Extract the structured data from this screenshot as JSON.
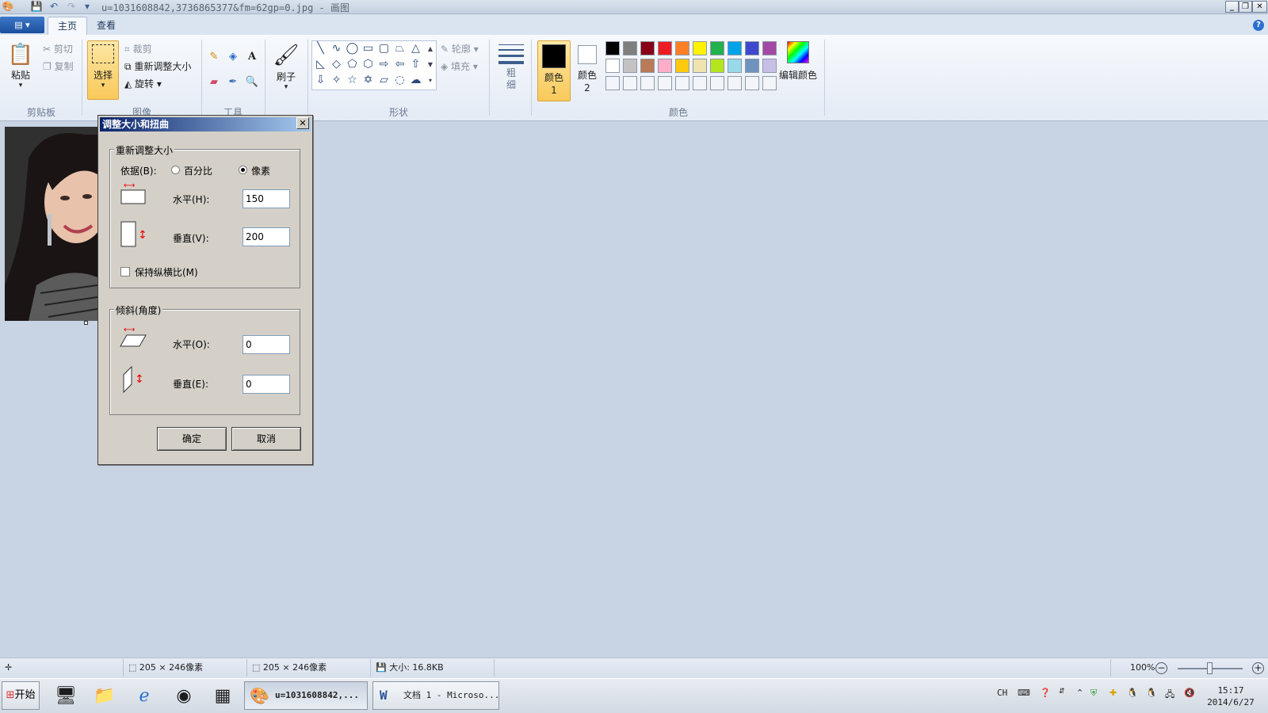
{
  "window": {
    "title": "u=1031608842,3736865377&fm=62gp=0.jpg - 画图"
  },
  "ribbon": {
    "tabs": [
      {
        "label": "主页"
      },
      {
        "label": "查看"
      }
    ],
    "clipboard": {
      "paste": "粘贴",
      "cut": "剪切",
      "copy": "复制",
      "group": "剪贴板"
    },
    "image": {
      "select": "选择",
      "crop": "裁剪",
      "resize": "重新调整大小",
      "rotate": "旋转",
      "group": "图像"
    },
    "tools": {
      "group": "工具"
    },
    "brushes": {
      "label": "刷子"
    },
    "shapes": {
      "outline": "轮廓",
      "fill": "填充",
      "group": "形状"
    },
    "size": {
      "label": "粗细"
    },
    "colors": {
      "color1": "颜色 1",
      "color2": "颜色 2",
      "edit": "编辑颜色",
      "group": "颜色",
      "palette_row1": [
        "#000000",
        "#7f7f7f",
        "#880015",
        "#ed1c24",
        "#ff7f27",
        "#fff200",
        "#22b14c",
        "#00a2e8",
        "#3f48cc",
        "#a349a4"
      ],
      "palette_row2": [
        "#ffffff",
        "#c3c3c3",
        "#b97a57",
        "#ffaec9",
        "#ffc90e",
        "#efe4b0",
        "#b5e61d",
        "#99d9ea",
        "#7092be",
        "#c8bfe7"
      ]
    }
  },
  "dialog": {
    "title": "调整大小和扭曲",
    "resize": {
      "legend": "重新调整大小",
      "basis_label": "依据(B):",
      "option_percent": "百分比",
      "option_pixels": "像素",
      "selected": "像素",
      "horizontal_label": "水平(H):",
      "horizontal_value": "150",
      "vertical_label": "垂直(V):",
      "vertical_value": "200",
      "keep_ratio_label": "保持纵横比(M)",
      "keep_ratio_checked": false
    },
    "skew": {
      "legend": "倾斜(角度)",
      "horizontal_label": "水平(O):",
      "horizontal_value": "0",
      "vertical_label": "垂直(E):",
      "vertical_value": "0"
    },
    "ok": "确定",
    "cancel": "取消"
  },
  "statusbar": {
    "selection_size": "205 × 246像素",
    "image_size": "205 × 246像素",
    "file_size": "大小: 16.8KB",
    "zoom": "100%"
  },
  "taskbar": {
    "start": "开始",
    "tasks": [
      {
        "label": "u=1031608842,..."
      },
      {
        "label": "文档 1 - Microso..."
      }
    ],
    "lang": "CH",
    "time": "15:17",
    "date": "2014/6/27"
  }
}
